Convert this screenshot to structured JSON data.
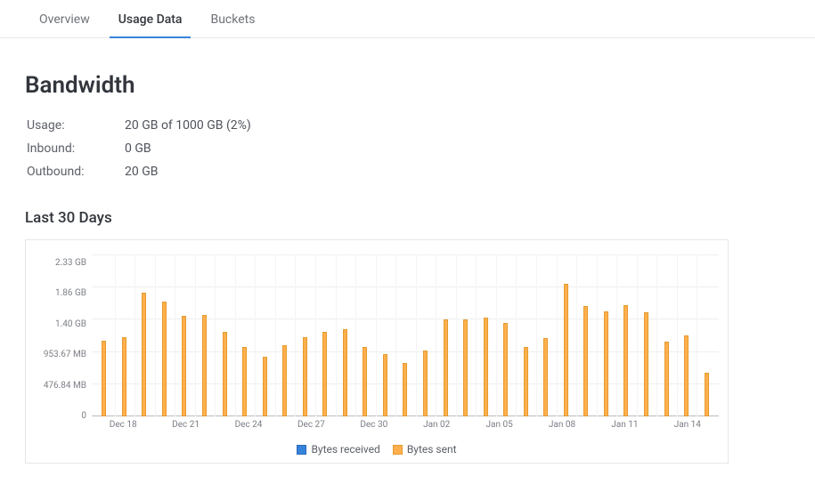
{
  "tabs": [
    {
      "label": "Overview",
      "active": false
    },
    {
      "label": "Usage Data",
      "active": true
    },
    {
      "label": "Buckets",
      "active": false
    }
  ],
  "section_title": "Bandwidth",
  "stats": {
    "usage_label": "Usage:",
    "usage_value": "20 GB of 1000 GB (2%)",
    "inbound_label": "Inbound:",
    "inbound_value": "0 GB",
    "outbound_label": "Outbound:",
    "outbound_value": "20 GB"
  },
  "last30_label": "Last 30 Days",
  "chart_data": {
    "type": "bar",
    "title": "",
    "xlabel": "",
    "ylabel": "",
    "y_ticks": [
      "2.33 GB",
      "1.86 GB",
      "1.40 GB",
      "953.67 MB",
      "476.84 MB",
      "0"
    ],
    "ylim_mb": [
      0,
      2385
    ],
    "x_tick_labels": [
      "Dec 18",
      "Dec 21",
      "Dec 24",
      "Dec 27",
      "Dec 30",
      "Jan 02",
      "Jan 05",
      "Jan 08",
      "Jan 11",
      "Jan 14"
    ],
    "x_tick_positions_pct": [
      5,
      15,
      25,
      35,
      45,
      55,
      65,
      75,
      85,
      95
    ],
    "legend": [
      {
        "name": "Bytes received",
        "kind": "recv"
      },
      {
        "name": "Bytes sent",
        "kind": "sent"
      }
    ],
    "series": [
      {
        "name": "Bytes received",
        "kind": "recv",
        "values_mb": [
          0,
          0,
          0,
          0,
          0,
          0,
          0,
          0,
          0,
          0,
          0,
          0,
          0,
          0,
          0,
          0,
          0,
          0,
          0,
          0,
          0,
          0,
          0,
          0,
          0,
          0,
          0,
          0,
          0,
          0
        ]
      },
      {
        "name": "Bytes sent",
        "kind": "sent",
        "values_mb": [
          1120,
          1170,
          1820,
          1690,
          1480,
          1500,
          1250,
          1020,
          880,
          1050,
          1170,
          1250,
          1290,
          1020,
          920,
          790,
          970,
          1430,
          1430,
          1450,
          1380,
          1020,
          1150,
          1950,
          1630,
          1550,
          1640,
          1530,
          1100,
          1190,
          640
        ]
      }
    ]
  }
}
